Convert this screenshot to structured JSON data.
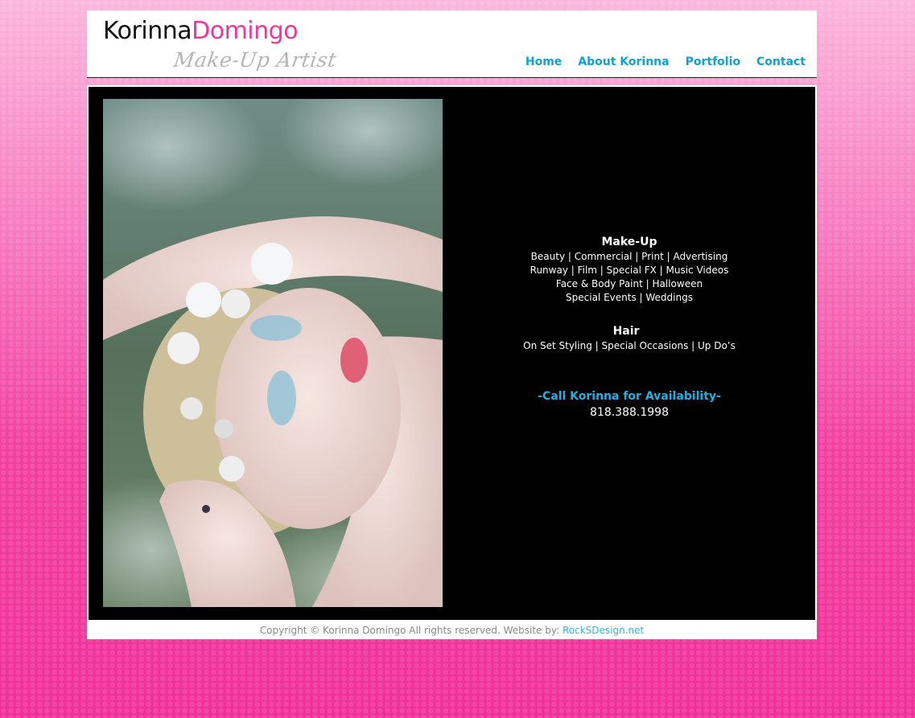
{
  "header": {
    "logo_first": "Korinna",
    "logo_last": "Domingo",
    "logo_tagline": "Make-Up Artist"
  },
  "nav": {
    "items": [
      {
        "label": "Home"
      },
      {
        "label": "About Korinna"
      },
      {
        "label": "Portfolio"
      },
      {
        "label": "Contact"
      }
    ]
  },
  "services": {
    "makeup_heading": "Make-Up",
    "makeup_lines": [
      "Beauty  |  Commercial  |  Print  |  Advertising",
      "Runway  |  Film  |  Special FX   |  Music Videos",
      "Face & Body Paint |  Halloween",
      "Special Events  |  Weddings"
    ],
    "hair_heading": "Hair",
    "hair_line": "On Set Styling  |  Special Occasions  |  Up Do’s",
    "cta": "-Call Korinna for Availability-",
    "phone": "818.388.1998"
  },
  "footer": {
    "copyright": "Copyright © Korinna Domingo All rights reserved.  Website by: ",
    "credit_link": "RockSDesign.net"
  },
  "colors": {
    "brand_pink": "#f0359b",
    "link_blue": "#0fa2cf",
    "cta_blue": "#1fb1e3"
  }
}
